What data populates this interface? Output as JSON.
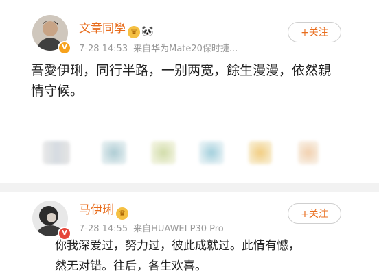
{
  "posts": [
    {
      "author": "文章同學",
      "time": "7-28 14:53",
      "source": "来自华为Mate20保时捷...",
      "follow_label": "+关注",
      "content_lines": [
        "吾愛伊琍，同行半路，一别两宽，餘生漫漫，依然親",
        "情守候。"
      ],
      "verified_color": "#f7a21c",
      "badge_icon": "gold-medal-icon",
      "extra_icon": "panda-icon"
    },
    {
      "author": "马伊琍",
      "time": "7-28 14:55",
      "source": "来自HUAWEI P30 Pro",
      "follow_label": "+关注",
      "content_lines": [
        "你我深爱过，努力过，彼此成就过。此情有憾，",
        "然无对错。往后，各生欢喜。"
      ],
      "verified_color": "#e5463a",
      "badge_icon": "gold-medal-icon"
    }
  ],
  "colors": {
    "name": "#e86c1c",
    "meta": "#999999",
    "text": "#222222",
    "separator": "#f2f2f2"
  }
}
